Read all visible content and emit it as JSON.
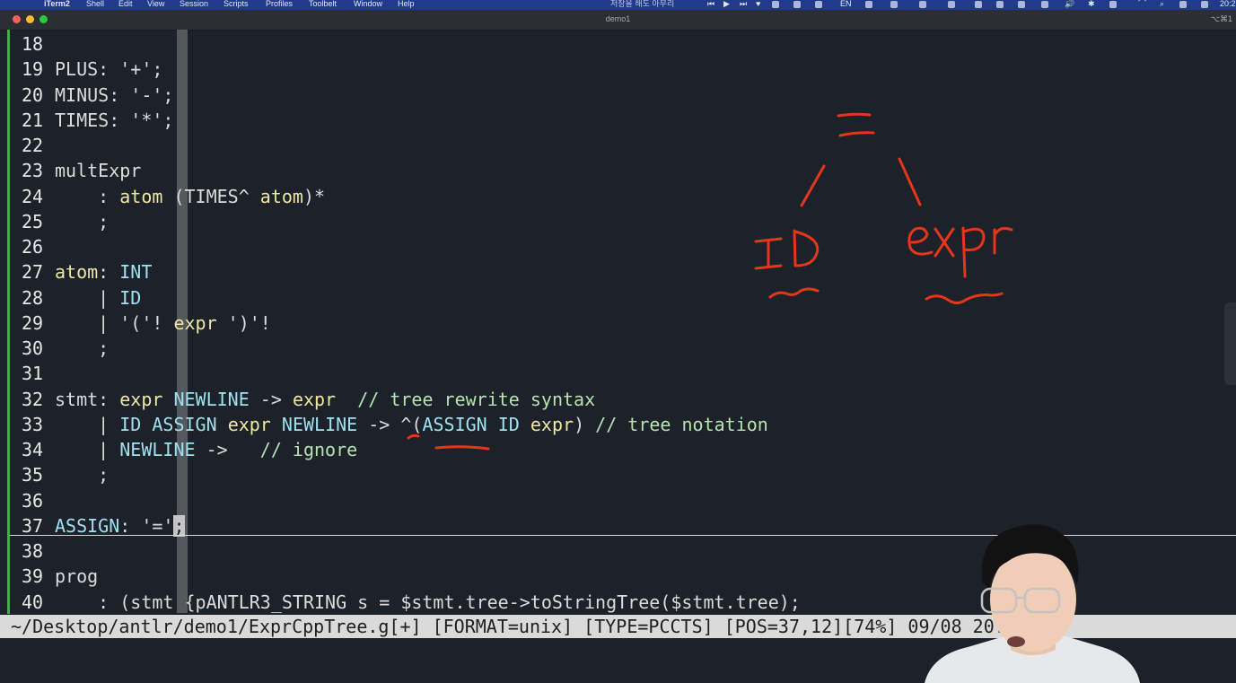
{
  "menubar": {
    "items": [
      "iTerm2",
      "Shell",
      "Edit",
      "View",
      "Session",
      "Scripts",
      "Profiles",
      "Toolbelt",
      "Window",
      "Help"
    ],
    "center_text": "저장을 해도 아무리",
    "lang": "EN",
    "time": "20:2"
  },
  "window": {
    "title": "demo1",
    "shortcut": "⌥⌘1"
  },
  "editor": {
    "lines": [
      {
        "n": "18",
        "code": ""
      },
      {
        "n": "19",
        "code": "PLUS: '+';"
      },
      {
        "n": "20",
        "code": "MINUS: '-';"
      },
      {
        "n": "21",
        "code": "TIMES: '*';"
      },
      {
        "n": "22",
        "code": ""
      },
      {
        "n": "23",
        "code": "multExpr"
      },
      {
        "n": "24",
        "code": "    : atom (TIMES^ atom)*"
      },
      {
        "n": "25",
        "code": "    ;"
      },
      {
        "n": "26",
        "code": ""
      },
      {
        "n": "27",
        "code": "atom: INT"
      },
      {
        "n": "28",
        "code": "    | ID"
      },
      {
        "n": "29",
        "code": "    | '('! expr ')'!"
      },
      {
        "n": "30",
        "code": "    ;"
      },
      {
        "n": "31",
        "code": ""
      },
      {
        "n": "32",
        "code": "stmt: expr NEWLINE -> expr  // tree rewrite syntax"
      },
      {
        "n": "33",
        "code": "    | ID ASSIGN expr NEWLINE -> ^(ASSIGN ID expr) // tree notation"
      },
      {
        "n": "34",
        "code": "    | NEWLINE ->   // ignore"
      },
      {
        "n": "35",
        "code": "    ;"
      },
      {
        "n": "36",
        "code": ""
      },
      {
        "n": "37",
        "code": "ASSIGN: '=';"
      },
      {
        "n": "38",
        "code": ""
      },
      {
        "n": "39",
        "code": "prog"
      },
      {
        "n": "40",
        "code": "    : (stmt {pANTLR3_STRING s = $stmt.tree->toStringTree($stmt.tree);"
      }
    ]
  },
  "statusline": {
    "text": "~/Desktop/antlr/demo1/ExprCppTree.g[+] [FORMAT=unix] [TYPE=PCCTS] [POS=37,12][74%] 09/08 20:20"
  },
  "annotation": {
    "root": "=",
    "left": "ID",
    "right": "expr"
  },
  "colors": {
    "background": "#1d2129",
    "annotation": "#e5361b",
    "gutter": "#3fae47",
    "statusline": "#dadada"
  }
}
